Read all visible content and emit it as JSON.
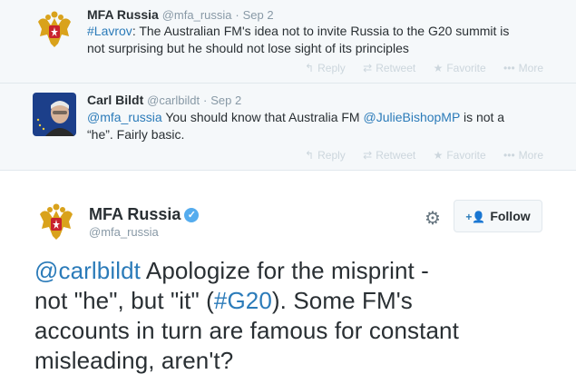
{
  "tweets": [
    {
      "name": "MFA Russia",
      "handle": "@mfa_russia",
      "date": "Sep 2",
      "text_hashtag": "#Lavrov",
      "text_rest_line1": ": The Australian FM's idea not to invite Russia to the G20 summit is",
      "text_line2": "not surprising but he should not lose sight of its principles",
      "actions": {
        "reply": "Reply",
        "retweet": "Retweet",
        "favorite": "Favorite",
        "more": "More"
      }
    },
    {
      "name": "Carl Bildt",
      "handle": "@carlbildt",
      "date": "Sep 2",
      "mention": "@mfa_russia",
      "text_mid": " You should know that Australia FM ",
      "mention2": "@JulieBishopMP",
      "text_end": " is not a",
      "text_line2": "“he”. Fairly basic.",
      "actions": {
        "reply": "Reply",
        "retweet": "Retweet",
        "favorite": "Favorite",
        "more": "More"
      }
    }
  ],
  "main": {
    "name": "MFA Russia",
    "handle": "@mfa_russia",
    "follow_label": "Follow",
    "mention": "@carlbildt",
    "text_a": " Apologize for the misprint -",
    "text_b": "not \"he\", but \"it\" (",
    "hashtag": "#G20",
    "text_c": "). Some FM's",
    "text_d": "accounts in turn are famous for constant",
    "text_e": "misleading, aren't?"
  },
  "colors": {
    "link": "#2b7bb9",
    "verified": "#55acee",
    "bg_light": "#f5f8fa"
  }
}
